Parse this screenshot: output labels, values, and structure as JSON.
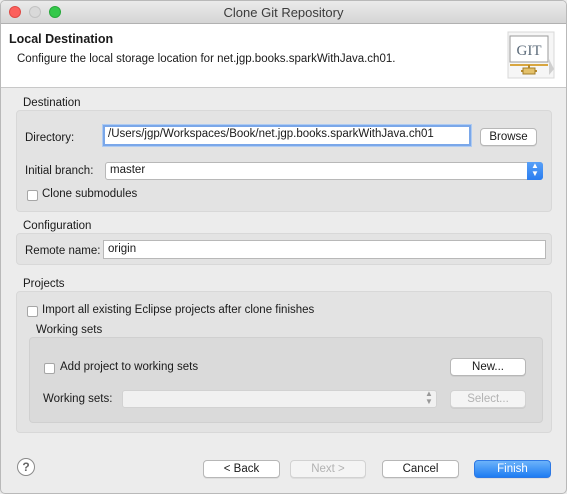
{
  "window": {
    "title": "Clone Git Repository"
  },
  "banner": {
    "title": "Local Destination",
    "description": "Configure the local storage location for net.jgp.books.sparkWithJava.ch01.",
    "logo_text": "GIT"
  },
  "destination": {
    "section_label": "Destination",
    "directory_label": "Directory:",
    "directory_value": "/Users/jgp/Workspaces/Book/net.jgp.books.sparkWithJava.ch01",
    "browse_label": "Browse",
    "branch_label": "Initial branch:",
    "branch_value": "master",
    "clone_submodules_label": "Clone submodules",
    "clone_submodules_checked": false
  },
  "configuration": {
    "section_label": "Configuration",
    "remote_label": "Remote name:",
    "remote_value": "origin"
  },
  "projects": {
    "section_label": "Projects",
    "import_label": "Import all existing Eclipse projects after clone finishes",
    "import_checked": false,
    "working_sets_title": "Working sets",
    "add_to_sets_label": "Add project to working sets",
    "add_to_sets_checked": false,
    "new_label": "New...",
    "working_sets_label": "Working sets:",
    "working_sets_value": "",
    "select_label": "Select..."
  },
  "footer": {
    "help_glyph": "?",
    "back_label": "< Back",
    "next_label": "Next >",
    "cancel_label": "Cancel",
    "finish_label": "Finish"
  },
  "colors": {
    "accent": "#1e7cf2",
    "close": "#fc605c",
    "maximize": "#34c84a"
  }
}
